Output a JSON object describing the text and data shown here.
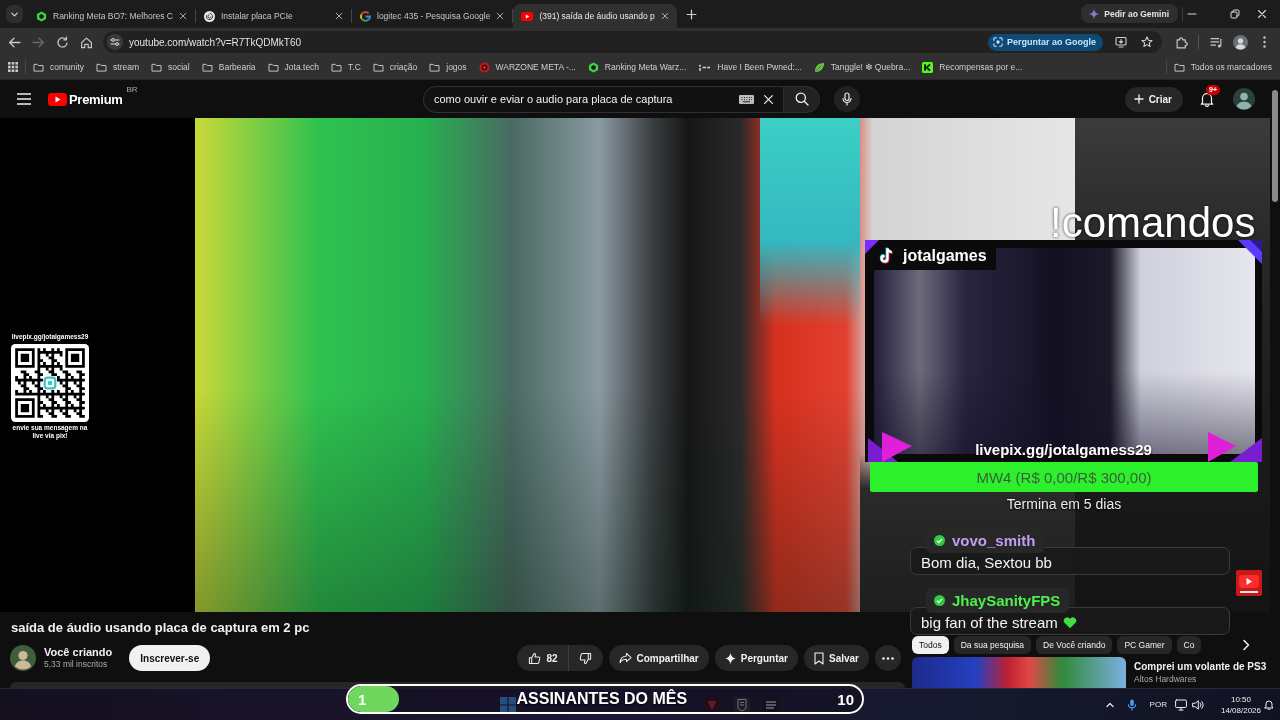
{
  "browser": {
    "tabs": [
      {
        "title": "Ranking Meta BO7: Melhores C",
        "kind": "hexagon",
        "selected": false
      },
      {
        "title": "Instalar placa PCIe",
        "kind": "knot",
        "selected": false
      },
      {
        "title": "logitec 435 - Pesquisa Google",
        "kind": "google",
        "selected": false
      },
      {
        "title": "(391) saída de áudio usando p",
        "kind": "youtube",
        "selected": true
      }
    ],
    "gemini_button": "Pedir ao Gemini",
    "forward_disabled": true,
    "address": "youtube.com/watch?v=R7TkQDMkT60",
    "ask_google_button": "Perguntar ao Google",
    "bookmarks": [
      {
        "label": "comunity",
        "kind": "folder"
      },
      {
        "label": "stream",
        "kind": "folder"
      },
      {
        "label": "social",
        "kind": "folder"
      },
      {
        "label": "Barbearia",
        "kind": "folder"
      },
      {
        "label": "Jota.tech",
        "kind": "folder"
      },
      {
        "label": "T.C",
        "kind": "folder"
      },
      {
        "label": "criação",
        "kind": "folder"
      },
      {
        "label": "jogos",
        "kind": "folder"
      },
      {
        "label": "WARZONE META -...",
        "kind": "target"
      },
      {
        "label": "Ranking Meta Warz...",
        "kind": "hexagon"
      },
      {
        "label": "Have I Been Pwned:...",
        "kind": "pwned"
      },
      {
        "label": "Tanggle! ❇ Quebra...",
        "kind": "leaf"
      },
      {
        "label": "Recompensas por e...",
        "kind": "k"
      }
    ],
    "all_bookmarks": "Todos os marcadores"
  },
  "youtube": {
    "logo": "Premium",
    "region": "BR",
    "search": {
      "value": "como ouvir e eviar o audio para placa de captura"
    },
    "create_button": "Criar",
    "notification_badge": "9+",
    "video": {
      "title": "saída de áudio usando placa de captura em 2 pc",
      "channel": "Você criando",
      "subscribers": "5,33 mil inscritos",
      "subscribe_button": "Inscrever-se",
      "likes": "82",
      "actions": [
        {
          "label": "Compartilhar",
          "kind": "share"
        },
        {
          "label": "Perguntar",
          "kind": "ask"
        },
        {
          "label": "Salvar",
          "kind": "save"
        }
      ]
    },
    "chips": [
      {
        "label": "Todos",
        "selected": true
      },
      {
        "label": "Da sua pesquisa",
        "selected": false
      },
      {
        "label": "De Você criando",
        "selected": false
      },
      {
        "label": "PC Gamer",
        "selected": false
      },
      {
        "label": "Co",
        "selected": false
      }
    ],
    "recommendations": [
      {
        "title": "Comprei um volante de PS3",
        "channel": "Altos Hardwares"
      }
    ]
  },
  "stream_overlay": {
    "qr_link": "livepix.gg/jotalgamess29",
    "qr_caption": "envie sua mensagem na live via pix!",
    "commands": "!comandos",
    "webcam": {
      "handle": "jotalgames",
      "link": "livepix.gg/jotalgamess29"
    },
    "goal": {
      "label": "MW4 (R$ 0,00/R$ 300,00)",
      "ends": "Termina em 5 dias"
    },
    "chat": [
      {
        "user": "vovo_smith",
        "color": "#c39cf2",
        "message": "Bom dia, Sextou bb",
        "heart": false
      },
      {
        "user": "JhaySanityFPS",
        "color": "#4cf04c",
        "message": "big fan of the stream",
        "heart": true
      }
    ]
  },
  "subscriber_goal": {
    "current": "1",
    "label": "ASSINANTES DO MÊS",
    "target": "10",
    "level": 0.1
  },
  "taskbar": {
    "language": "POR",
    "time": "10:50",
    "date": "14/08/2026"
  }
}
